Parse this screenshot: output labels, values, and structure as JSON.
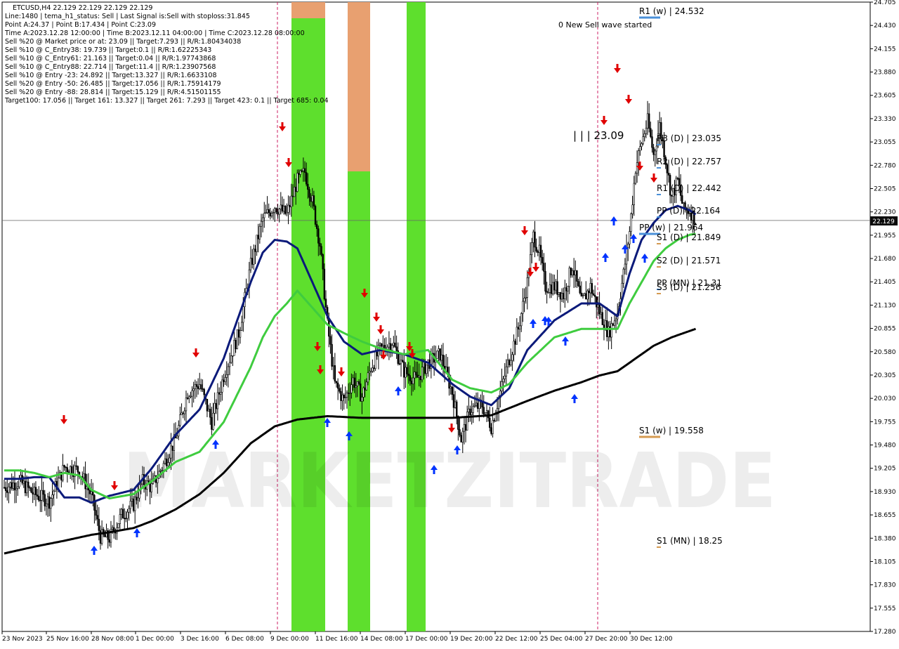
{
  "header": {
    "symbol_line": "ETCUSD,H4  22.129 22.129 22.129 22.129",
    "info_lines": [
      "Line:1480 | tema_h1_status: Sell | Last Signal is:Sell with stoploss:31.845",
      "Point A:24.37 | Point B:17.434 | Point C:23.09",
      "Time A:2023.12.28 12:00:00 | Time B:2023.12.11 04:00:00 | Time C:2023.12.28 08:00:00",
      "Sell %20 @ Market price or at: 23.09 || Target:7.293 || R/R:1.80434038",
      "Sell %10 @ C_Entry38: 19.739 || Target:0.1 || R/R:1.62225343",
      "Sell %10 @ C_Entry61: 21.163 || Target:0.04 || R/R:1.97743868",
      "Sell %10 @ C_Entry88: 22.714 || Target:11.4 || R/R:1.23907568",
      "Sell %10 @ Entry -23: 24.892 || Target:13.327 || R/R:1.6633108",
      "Sell %20 @ Entry -50: 26.485 || Target:17.056 || R/R:1.75914179",
      "Sell %20 @ Entry -88: 28.814 || Target:15.129 || R/R:4.51501155",
      "Target100: 17.056 || Target 161: 13.327 || Target 261: 7.293 || Target 423: 0.1 || Target 685: 0.04"
    ]
  },
  "watermark": "MARKETZITRADE",
  "annotations": {
    "wave_text": "0 New Sell wave started",
    "c_label": "| | | 23.09"
  },
  "current_price": "22.129",
  "colors": {
    "blue_ma": "#0b1a7a",
    "green_ma": "#3fcc3f",
    "black_ma": "#000000",
    "zone_green": "#55dd22",
    "zone_orange": "#e8a070",
    "sell_arrow": "#e00000",
    "buy_arrow": "#0033ff"
  },
  "chart_data": {
    "type": "candlestick",
    "symbol": "ETCUSD",
    "timeframe": "H4",
    "ylim": [
      17.28,
      24.705
    ],
    "y_ticks": [
      "24.705",
      "24.430",
      "24.155",
      "23.880",
      "23.605",
      "23.330",
      "23.055",
      "22.780",
      "22.505",
      "22.230",
      "21.955",
      "21.680",
      "21.405",
      "21.130",
      "20.855",
      "20.580",
      "20.305",
      "20.030",
      "19.755",
      "19.480",
      "19.205",
      "18.930",
      "18.655",
      "18.380",
      "18.105",
      "17.830",
      "17.555",
      "17.280"
    ],
    "x_ticks": [
      "23 Nov 2023",
      "25 Nov 16:00",
      "28 Nov 08:00",
      "1 Dec 00:00",
      "3 Dec 16:00",
      "6 Dec 08:00",
      "9 Dec 00:00",
      "11 Dec 16:00",
      "14 Dec 08:00",
      "17 Dec 00:00",
      "19 Dec 20:00",
      "22 Dec 12:00",
      "25 Dec 04:00",
      "27 Dec 20:00",
      "30 Dec 12:00"
    ],
    "price_anchors": [
      [
        0,
        18.98
      ],
      [
        10,
        19.05
      ],
      [
        20,
        18.9
      ],
      [
        30,
        18.82
      ],
      [
        40,
        19.22
      ],
      [
        50,
        19.18
      ],
      [
        58,
        18.88
      ],
      [
        64,
        18.4
      ],
      [
        70,
        18.38
      ],
      [
        78,
        18.65
      ],
      [
        86,
        18.78
      ],
      [
        92,
        19.05
      ],
      [
        98,
        18.98
      ],
      [
        106,
        19.25
      ],
      [
        114,
        19.55
      ],
      [
        122,
        20.1
      ],
      [
        130,
        20.2
      ],
      [
        138,
        19.75
      ],
      [
        146,
        20.3
      ],
      [
        156,
        20.8
      ],
      [
        164,
        21.6
      ],
      [
        172,
        22.15
      ],
      [
        180,
        22.3
      ],
      [
        188,
        22.2
      ],
      [
        195,
        22.6
      ],
      [
        200,
        22.7
      ],
      [
        205,
        22.35
      ],
      [
        210,
        21.85
      ],
      [
        215,
        20.9
      ],
      [
        220,
        20.2
      ],
      [
        226,
        20.0
      ],
      [
        232,
        20.25
      ],
      [
        238,
        20.05
      ],
      [
        244,
        20.4
      ],
      [
        250,
        20.6
      ],
      [
        258,
        20.7
      ],
      [
        266,
        20.35
      ],
      [
        274,
        20.25
      ],
      [
        282,
        20.45
      ],
      [
        290,
        20.55
      ],
      [
        298,
        20.1
      ],
      [
        304,
        19.55
      ],
      [
        310,
        19.9
      ],
      [
        318,
        19.95
      ],
      [
        324,
        19.7
      ],
      [
        330,
        20.1
      ],
      [
        336,
        20.5
      ],
      [
        342,
        20.85
      ],
      [
        348,
        21.4
      ],
      [
        352,
        21.95
      ],
      [
        356,
        21.75
      ],
      [
        360,
        21.35
      ],
      [
        366,
        21.35
      ],
      [
        372,
        21.25
      ],
      [
        378,
        21.6
      ],
      [
        384,
        21.15
      ],
      [
        390,
        21.35
      ],
      [
        396,
        21.05
      ],
      [
        402,
        20.8
      ],
      [
        408,
        21.05
      ],
      [
        412,
        21.5
      ],
      [
        416,
        22.0
      ],
      [
        420,
        22.75
      ],
      [
        424,
        23.05
      ],
      [
        428,
        23.3
      ],
      [
        432,
        22.9
      ],
      [
        436,
        23.25
      ],
      [
        440,
        22.85
      ],
      [
        444,
        22.4
      ],
      [
        448,
        22.6
      ],
      [
        452,
        22.25
      ],
      [
        456,
        22.25
      ],
      [
        460,
        22.13
      ]
    ],
    "series": [
      {
        "name": "",
        "color": "#0b1a7a",
        "anchors": [
          [
            0,
            19.08
          ],
          [
            10,
            19.08
          ],
          [
            20,
            19.1
          ],
          [
            30,
            19.1
          ],
          [
            40,
            18.86
          ],
          [
            50,
            18.86
          ],
          [
            58,
            18.8
          ],
          [
            70,
            18.88
          ],
          [
            86,
            18.95
          ],
          [
            98,
            19.2
          ],
          [
            114,
            19.6
          ],
          [
            130,
            19.9
          ],
          [
            146,
            20.5
          ],
          [
            164,
            21.4
          ],
          [
            172,
            21.75
          ],
          [
            180,
            21.9
          ],
          [
            188,
            21.88
          ],
          [
            195,
            21.8
          ],
          [
            205,
            21.4
          ],
          [
            215,
            21.0
          ],
          [
            226,
            20.7
          ],
          [
            238,
            20.55
          ],
          [
            250,
            20.6
          ],
          [
            266,
            20.55
          ],
          [
            282,
            20.45
          ],
          [
            298,
            20.2
          ],
          [
            310,
            20.05
          ],
          [
            324,
            19.95
          ],
          [
            336,
            20.15
          ],
          [
            348,
            20.6
          ],
          [
            366,
            20.95
          ],
          [
            384,
            21.15
          ],
          [
            396,
            21.15
          ],
          [
            408,
            21.0
          ],
          [
            416,
            21.5
          ],
          [
            424,
            21.9
          ],
          [
            432,
            22.1
          ],
          [
            440,
            22.25
          ],
          [
            448,
            22.3
          ],
          [
            456,
            22.25
          ],
          [
            460,
            22.2
          ]
        ]
      },
      {
        "name": "",
        "color": "#3fcc3f",
        "anchors": [
          [
            0,
            19.18
          ],
          [
            10,
            19.18
          ],
          [
            20,
            19.15
          ],
          [
            30,
            19.1
          ],
          [
            40,
            19.15
          ],
          [
            50,
            19.12
          ],
          [
            58,
            18.95
          ],
          [
            70,
            18.85
          ],
          [
            86,
            18.9
          ],
          [
            98,
            19.05
          ],
          [
            114,
            19.28
          ],
          [
            130,
            19.4
          ],
          [
            146,
            19.75
          ],
          [
            164,
            20.4
          ],
          [
            172,
            20.75
          ],
          [
            180,
            21.0
          ],
          [
            188,
            21.15
          ],
          [
            195,
            21.3
          ],
          [
            205,
            21.1
          ],
          [
            215,
            20.9
          ],
          [
            226,
            20.8
          ],
          [
            238,
            20.7
          ],
          [
            250,
            20.62
          ],
          [
            266,
            20.55
          ],
          [
            282,
            20.6
          ],
          [
            298,
            20.25
          ],
          [
            310,
            20.15
          ],
          [
            324,
            20.1
          ],
          [
            336,
            20.2
          ],
          [
            348,
            20.45
          ],
          [
            366,
            20.75
          ],
          [
            384,
            20.85
          ],
          [
            396,
            20.85
          ],
          [
            408,
            20.85
          ],
          [
            416,
            21.15
          ],
          [
            424,
            21.4
          ],
          [
            432,
            21.65
          ],
          [
            440,
            21.8
          ],
          [
            448,
            21.9
          ],
          [
            456,
            21.96
          ],
          [
            460,
            21.97
          ]
        ]
      },
      {
        "name": "",
        "color": "#000000",
        "anchors": [
          [
            0,
            18.2
          ],
          [
            20,
            18.28
          ],
          [
            40,
            18.35
          ],
          [
            58,
            18.42
          ],
          [
            70,
            18.45
          ],
          [
            86,
            18.5
          ],
          [
            98,
            18.58
          ],
          [
            114,
            18.72
          ],
          [
            130,
            18.9
          ],
          [
            146,
            19.15
          ],
          [
            164,
            19.5
          ],
          [
            180,
            19.7
          ],
          [
            195,
            19.78
          ],
          [
            215,
            19.82
          ],
          [
            238,
            19.8
          ],
          [
            266,
            19.8
          ],
          [
            298,
            19.8
          ],
          [
            324,
            19.83
          ],
          [
            348,
            20.0
          ],
          [
            366,
            20.12
          ],
          [
            384,
            20.22
          ],
          [
            396,
            20.3
          ],
          [
            408,
            20.35
          ],
          [
            420,
            20.5
          ],
          [
            432,
            20.65
          ],
          [
            444,
            20.75
          ],
          [
            460,
            20.85
          ]
        ]
      }
    ],
    "levels": [
      {
        "label": "R1 (w) | 24.532",
        "value": 24.532,
        "color": "#4a90d9"
      },
      {
        "label": "R3 (D) | 23.035",
        "value": 23.035,
        "color": "#4a90d9"
      },
      {
        "label": "R2 (D) | 22.757",
        "value": 22.757,
        "color": "#4a90d9"
      },
      {
        "label": "R1 (D) | 22.442",
        "value": 22.442,
        "color": "#4a90d9"
      },
      {
        "label": "PP (D) | 22.164",
        "value": 22.164,
        "color": "#4a90d9"
      },
      {
        "label": "PP (w) | 21.964",
        "value": 21.964,
        "color": "#4a90d9"
      },
      {
        "label": "S1 (D) | 21.849",
        "value": 21.849,
        "color": "#d49a50"
      },
      {
        "label": "S2 (D) | 21.571",
        "value": 21.571,
        "color": "#d49a50"
      },
      {
        "label": "PP (MN) | 21.31",
        "value": 21.31,
        "color": "#4a90d9"
      },
      {
        "label": "S3 (D) | 21.256",
        "value": 21.256,
        "color": "#d49a50"
      },
      {
        "label": "S1 (w) | 19.558",
        "value": 19.558,
        "color": "#d49a50"
      },
      {
        "label": "S1 (MN) | 18.25",
        "value": 18.25,
        "color": "#d49a50"
      }
    ]
  }
}
